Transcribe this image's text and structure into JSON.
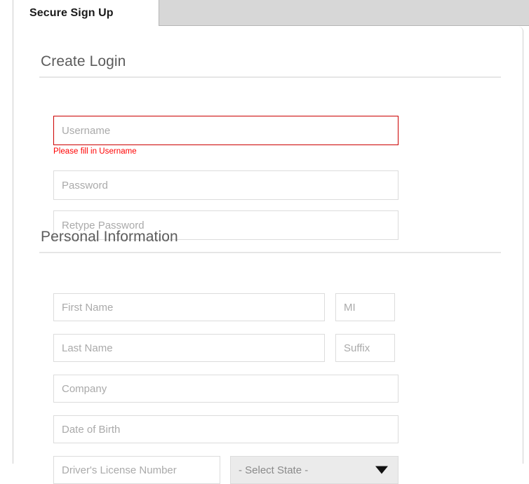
{
  "tab": {
    "active_label": "Secure Sign Up"
  },
  "sections": [
    {
      "heading": "Create Login",
      "fields": [
        {
          "name": "username",
          "placeholder": "Username",
          "value": "",
          "error": "Please fill in Username"
        },
        {
          "name": "password",
          "placeholder": "Password",
          "value": ""
        },
        {
          "name": "retype-password",
          "placeholder": "Retype Password",
          "value": ""
        }
      ]
    },
    {
      "heading": "Personal Information",
      "fields": [
        {
          "name": "first-name",
          "placeholder": "First Name",
          "value": ""
        },
        {
          "name": "mi",
          "placeholder": "MI",
          "value": ""
        },
        {
          "name": "last-name",
          "placeholder": "Last Name",
          "value": ""
        },
        {
          "name": "suffix",
          "placeholder": "Suffix",
          "value": ""
        },
        {
          "name": "company",
          "placeholder": "Company",
          "value": ""
        },
        {
          "name": "date-of-birth",
          "placeholder": "Date of Birth",
          "value": ""
        },
        {
          "name": "drivers-license-number",
          "placeholder": "Driver's License Number",
          "value": ""
        }
      ],
      "select": {
        "name": "state-select",
        "selected": "- Select State -",
        "arrow_icon": "chevron-down-icon"
      }
    }
  ],
  "colors": {
    "error_red": "#ff0000",
    "error_border": "#cc0000",
    "heading_gray": "#5c5c5c",
    "field_border": "#dcdcdc",
    "placeholder_gray": "#aaaaaa",
    "tab_inactive_gray": "#d7d7d7",
    "select_bg": "#ebebeb"
  }
}
